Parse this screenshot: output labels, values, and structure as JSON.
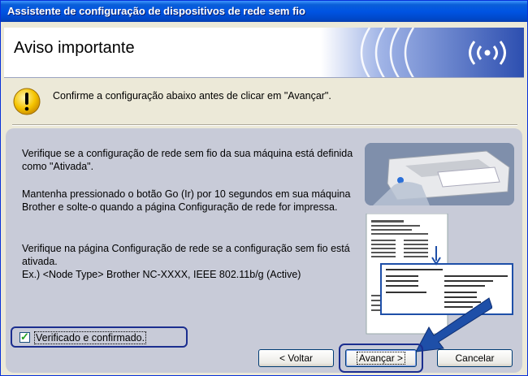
{
  "window": {
    "title": "Assistente de configuração de dispositivos de rede sem fio"
  },
  "header": {
    "title": "Aviso importante"
  },
  "notice": {
    "text": "Confirme a configuração abaixo antes de clicar em \"Avançar\"."
  },
  "instructions": {
    "p1": "Verifique se a configuração de rede sem fio da sua máquina está definida como \"Ativada\".",
    "p2": "Mantenha pressionado o botão Go (Ir) por 10 segundos em sua máquina Brother e solte-o quando a página Configuração de rede for impressa.",
    "p3_line1": "Verifique na página Configuração de rede se a configuração sem fio está ativada.",
    "p3_line2": "Ex.) <Node Type> Brother NC-XXXX, IEEE 802.11b/g (Active)"
  },
  "checkbox": {
    "label": "Verificado e confirmado.",
    "checked": true
  },
  "buttons": {
    "back": "< Voltar",
    "next": "Avançar >",
    "cancel": "Cancelar"
  },
  "colors": {
    "titlebar": "#0054e3",
    "panel": "#c8cbd8",
    "highlight": "#1b2e8f",
    "arrow": "#1e4fa8"
  }
}
